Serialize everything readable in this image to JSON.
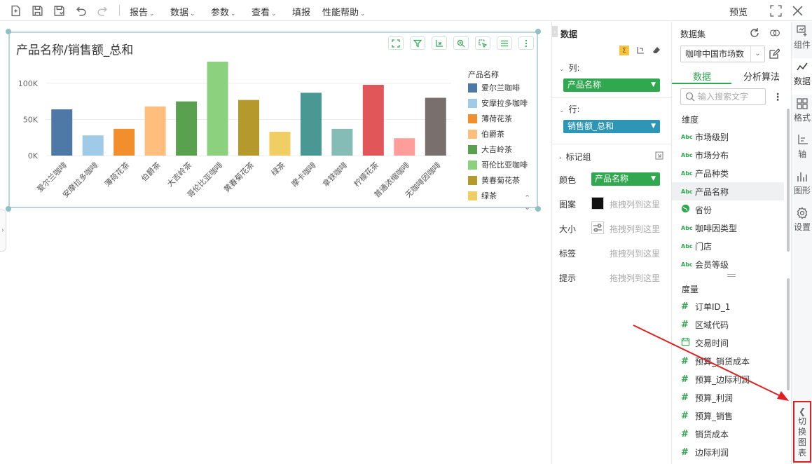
{
  "toolbar": {
    "menus": [
      {
        "label": "报告",
        "has_arrow": true
      },
      {
        "label": "数据",
        "has_arrow": true
      },
      {
        "label": "参数",
        "has_arrow": true
      },
      {
        "label": "查看",
        "has_arrow": true
      },
      {
        "label": "填报",
        "has_arrow": false
      },
      {
        "label": "性能帮助",
        "has_arrow": true
      }
    ],
    "preview_label": "预览"
  },
  "card": {
    "title": "产品名称/销售额_总和"
  },
  "chart_data": {
    "type": "bar",
    "title": "产品名称/销售额_总和",
    "categories": [
      "爱尔兰咖啡",
      "安摩拉多咖啡",
      "薄荷花茶",
      "伯爵茶",
      "大吉岭茶",
      "哥伦比亚咖啡",
      "黄春菊花茶",
      "绿茶",
      "摩卡咖啡",
      "拿铁咖啡",
      "柠檬花茶",
      "普通浓缩咖啡",
      "无咖啡因咖啡"
    ],
    "values": [
      64000,
      28000,
      37000,
      68000,
      75000,
      130000,
      77000,
      33000,
      87000,
      37000,
      98000,
      24000,
      80000
    ],
    "colors": [
      "#4e79a7",
      "#a0cbe8",
      "#f28e2b",
      "#ffbe7d",
      "#59a14f",
      "#8cd17d",
      "#b6992d",
      "#f1ce63",
      "#499894",
      "#86bcb6",
      "#e15759",
      "#ff9d9a",
      "#79706e"
    ],
    "ytick_labels": [
      "0K",
      "50K",
      "100K"
    ],
    "yticks": [
      0,
      50000,
      100000
    ],
    "ylim": [
      0,
      130000
    ],
    "legend_title": "产品名称",
    "legend_entries": [
      "爱尔兰咖啡",
      "安摩拉多咖啡",
      "薄荷花茶",
      "伯爵茶",
      "大吉岭茶",
      "哥伦比亚咖啡",
      "黄春菊花茶",
      "绿茶"
    ],
    "legend_placement": "right",
    "grid": true
  },
  "data_panel": {
    "title": "数据",
    "columns_label": "列:",
    "columns_field": "产品名称",
    "rows_label": "行:",
    "rows_field": "销售额_总和",
    "marks_label": "标记组",
    "color_label": "颜色",
    "color_field": "产品名称",
    "shape_label": "图案",
    "size_label": "大小",
    "label_label": "标签",
    "tooltip_label": "提示",
    "drop_hint": "拖拽列到这里"
  },
  "fields_panel": {
    "title": "数据集",
    "dataset": "咖啡中国市场数",
    "tabs": [
      "数据",
      "分析算法"
    ],
    "search_placeholder": "输入搜索文字",
    "dimensions_title": "维度",
    "dimensions": [
      {
        "label": "市场级别",
        "icon": "abc"
      },
      {
        "label": "市场分布",
        "icon": "abc"
      },
      {
        "label": "产品种类",
        "icon": "abc"
      },
      {
        "label": "产品名称",
        "icon": "abc",
        "selected": true
      },
      {
        "label": "省份",
        "icon": "globe"
      },
      {
        "label": "咖啡因类型",
        "icon": "abc"
      },
      {
        "label": "门店",
        "icon": "abc"
      },
      {
        "label": "会员等级",
        "icon": "abc"
      }
    ],
    "measures_title": "度量",
    "measures": [
      {
        "label": "订单ID_1",
        "icon": "hash"
      },
      {
        "label": "区域代码",
        "icon": "hash"
      },
      {
        "label": "交易时间",
        "icon": "calendar"
      },
      {
        "label": "预算_销货成本",
        "icon": "hash"
      },
      {
        "label": "预算_边际利润",
        "icon": "hash"
      },
      {
        "label": "预算_利润",
        "icon": "hash"
      },
      {
        "label": "预算_销售",
        "icon": "hash"
      },
      {
        "label": "销货成本",
        "icon": "hash"
      },
      {
        "label": "边际利润",
        "icon": "hash"
      }
    ]
  },
  "right_rail": {
    "items": [
      {
        "label": "组件",
        "icon": "component-icon"
      },
      {
        "label": "数据",
        "icon": "data-line-icon",
        "active": true
      },
      {
        "label": "格式",
        "icon": "grid-format-icon"
      },
      {
        "label": "轴",
        "icon": "axis-icon"
      },
      {
        "label": "图形",
        "icon": "bar-graph-icon"
      },
      {
        "label": "设置",
        "icon": "gear-icon"
      }
    ],
    "switch_chart_label": "切换图表"
  },
  "colors": {
    "accent_green": "#2fa84f",
    "pill_blue": "#2d96b6",
    "annotation_red": "#e02020"
  }
}
